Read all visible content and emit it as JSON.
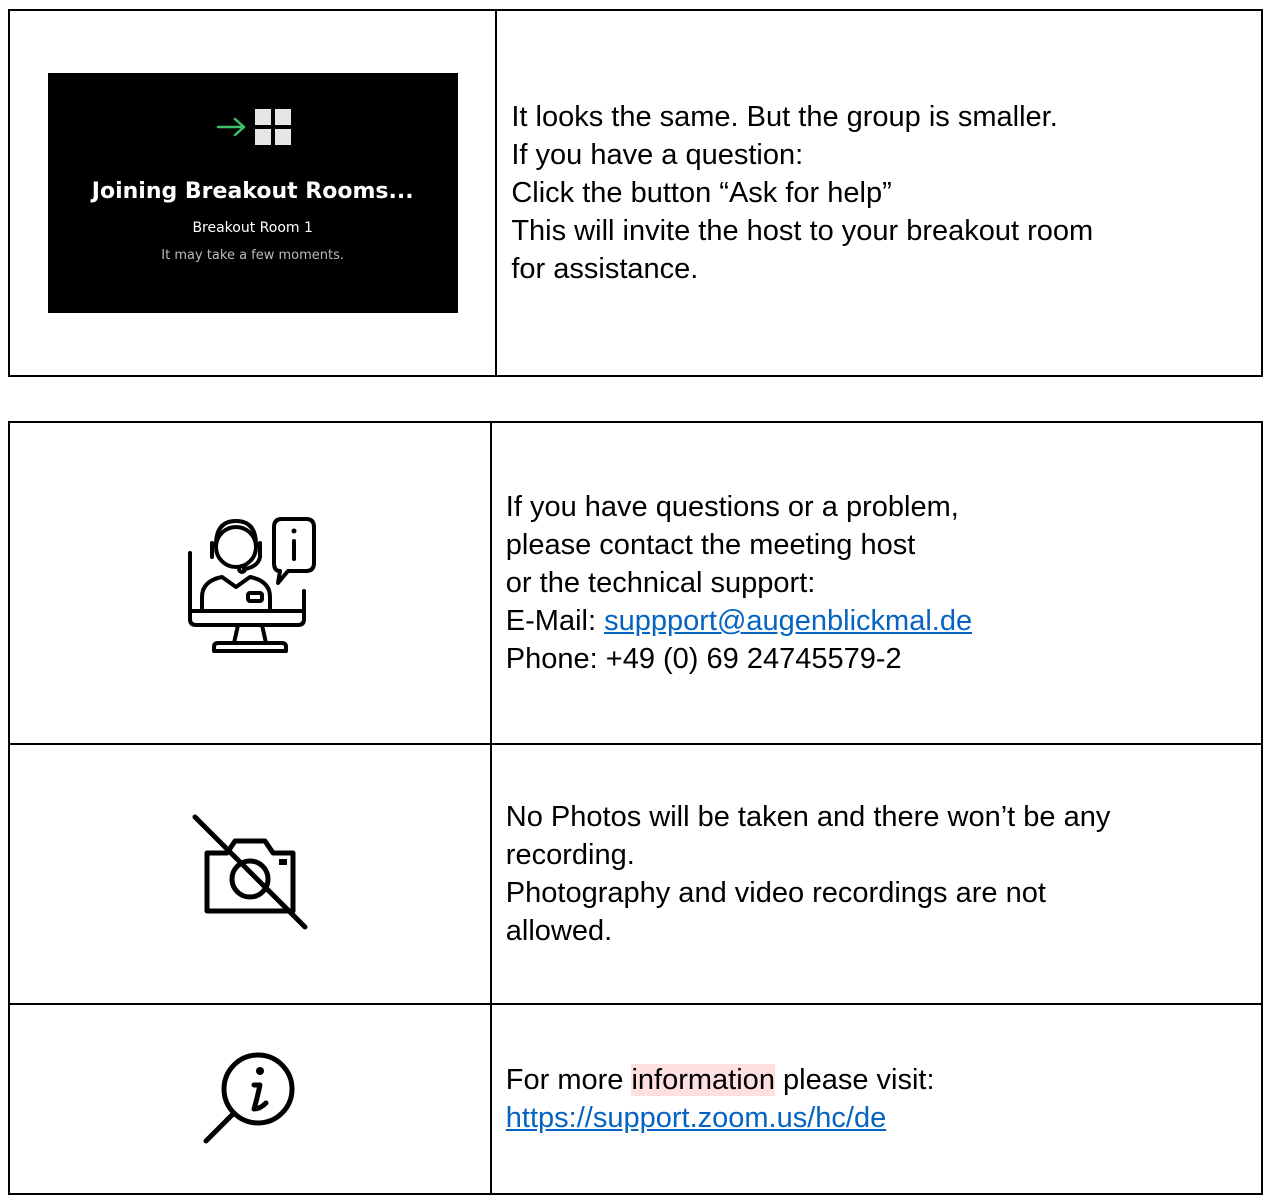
{
  "section1": {
    "screenshot": {
      "title": "Joining Breakout Rooms...",
      "room": "Breakout Room 1",
      "note": "It may take a few moments.",
      "arrow_color": "#3fbf6a",
      "icons": [
        "arrow-right-icon",
        "grid-icon"
      ]
    },
    "text": [
      "It looks the same. But the group is smaller.",
      "If you have a question:",
      "Click the button “Ask for help”",
      "This will invite the host to your breakout room",
      "for assistance."
    ]
  },
  "section2": {
    "support": {
      "icon": "support-agent-icon",
      "lines": [
        "If you have questions or a problem,",
        "please contact the meeting host",
        "or the technical support:"
      ],
      "email_label": "E-Mail: ",
      "email": "suppport@augenblickmal.de",
      "phone": "Phone: +49 (0) 69 24745579-2"
    },
    "photo": {
      "icon": "no-camera-icon",
      "lines": [
        "No Photos will be taken and there won’t be any",
        "recording.",
        "Photography and video recordings are not",
        "allowed."
      ]
    },
    "info": {
      "icon": "info-search-icon",
      "text_before": "For more ",
      "highlight": "information",
      "text_after": " please visit:",
      "link": "https://support.zoom.us/hc/de"
    }
  },
  "colors": {
    "link": "#0563c1",
    "highlight": "#ffe0e0",
    "screenshot_bg": "#000000"
  }
}
